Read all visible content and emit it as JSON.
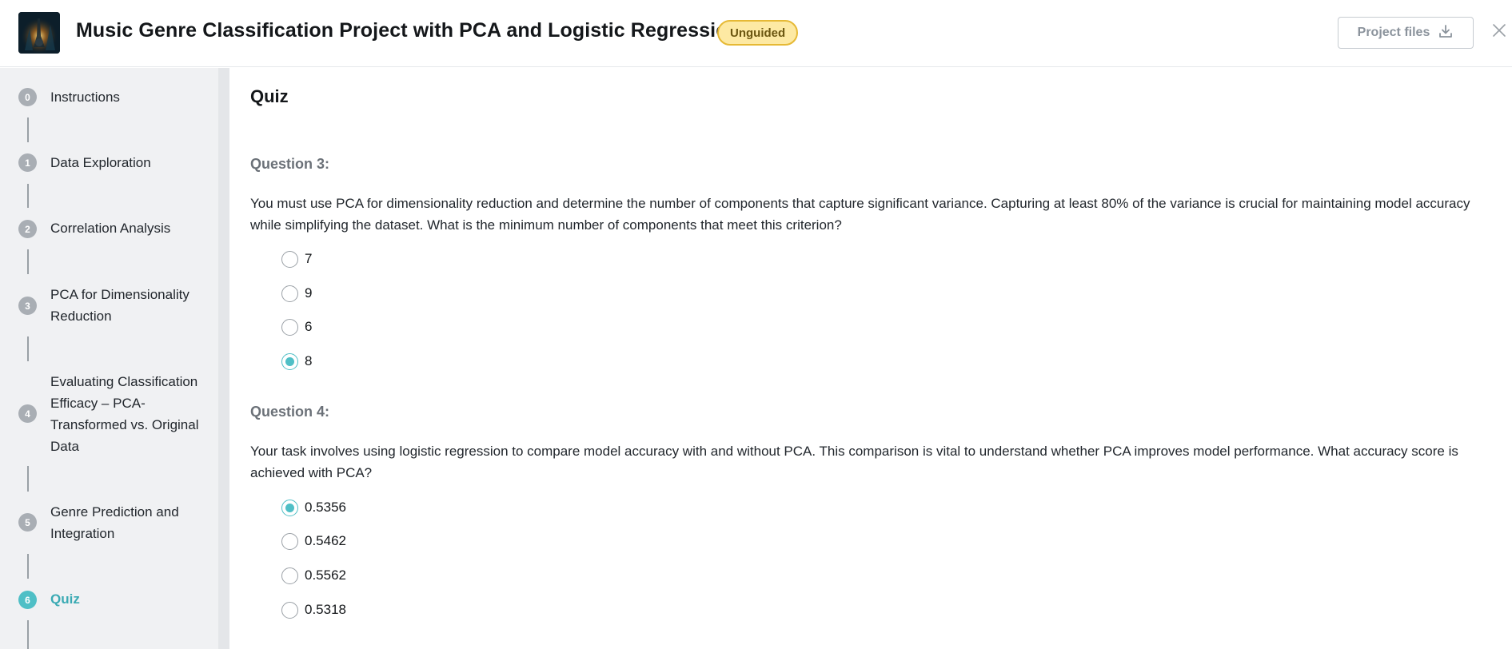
{
  "header": {
    "title": "Music Genre Classification Project with PCA and Logistic Regression",
    "badge": "Unguided",
    "project_files_label": "Project files"
  },
  "sidebar": {
    "steps": [
      {
        "number": "0",
        "label": "Instructions"
      },
      {
        "number": "1",
        "label": "Data Exploration"
      },
      {
        "number": "2",
        "label": "Correlation Analysis"
      },
      {
        "number": "3",
        "label": "PCA for Dimensionality Reduction"
      },
      {
        "number": "4",
        "label": "Evaluating Classification Efficacy – PCA-Transformed vs. Original Data"
      },
      {
        "number": "5",
        "label": "Genre Prediction and Integration"
      },
      {
        "number": "6",
        "label": "Quiz"
      }
    ],
    "active_step": "6"
  },
  "main": {
    "title": "Quiz",
    "questions": [
      {
        "heading": "Question 3:",
        "text": "You must use PCA for dimensionality reduction and determine the number of components that capture significant variance. Capturing at least 80% of the variance is crucial for maintaining model accuracy while simplifying the dataset. What is the minimum number of components that meet this criterion?",
        "options": [
          "7",
          "9",
          "6",
          "8"
        ],
        "selected": "8"
      },
      {
        "heading": "Question 4:",
        "text": "Your task involves using logistic regression to compare model accuracy with and without PCA. This comparison is vital to understand whether PCA improves model performance. What accuracy score is achieved with PCA?",
        "options": [
          "0.5356",
          "0.5462",
          "0.5562",
          "0.5318"
        ],
        "selected": "0.5356"
      }
    ]
  },
  "colors": {
    "accent": "#4fbfc6",
    "badge_bg": "#fde9a3",
    "badge_border": "#e6b935",
    "sidebar_bg": "#f0f1f3"
  },
  "icons": {
    "download": "download-icon",
    "close": "close-icon",
    "project_thumbnail": "project-thumbnail"
  }
}
